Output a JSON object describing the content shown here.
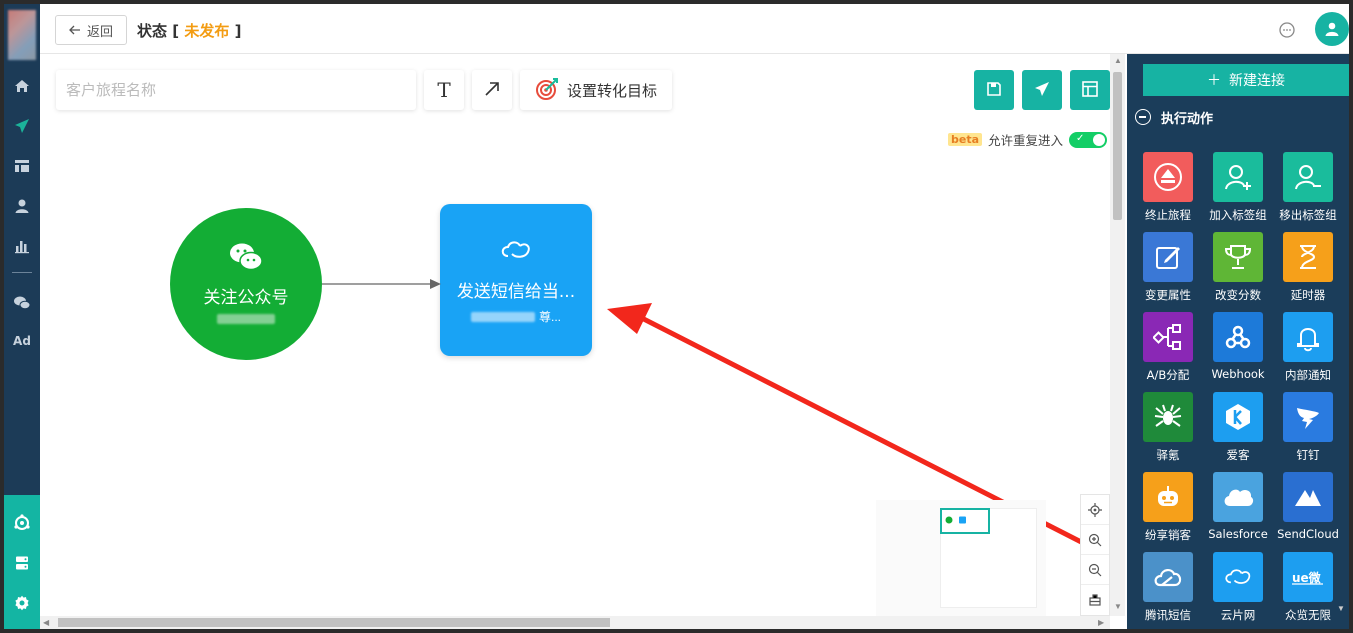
{
  "topbar": {
    "back_label": "返回",
    "status_prefix": "状态",
    "bracket_open": "[",
    "status_value": "未发布",
    "bracket_close": "]"
  },
  "toolbar": {
    "journey_name_placeholder": "客户旅程名称",
    "text_tool_glyph": "T",
    "goal_label": "设置转化目标"
  },
  "reentry": {
    "badge": "beta",
    "label": "允许重复进入",
    "enabled": true
  },
  "nodes": [
    {
      "title": "关注公众号",
      "icon": "wechat-icon"
    },
    {
      "title": "发送短信给当...",
      "subtitle_suffix": "尊...",
      "icon": "sms-cloud-icon"
    }
  ],
  "right_panel": {
    "new_connection": "新建连接",
    "section_title": "执行动作",
    "actions": [
      {
        "label": "终止旅程",
        "color": "#f25c5c",
        "icon": "eject-icon"
      },
      {
        "label": "加入标签组",
        "color": "#1abc9c",
        "icon": "user-add-icon"
      },
      {
        "label": "移出标签组",
        "color": "#1abc9c",
        "icon": "user-remove-icon"
      },
      {
        "label": "变更属性",
        "color": "#3a78d6",
        "icon": "edit-icon"
      },
      {
        "label": "改变分数",
        "color": "#5fb636",
        "icon": "trophy-icon"
      },
      {
        "label": "延时器",
        "color": "#f6a01a",
        "icon": "hourglass-icon"
      },
      {
        "label": "A/B分配",
        "color": "#8a28b5",
        "icon": "split-icon"
      },
      {
        "label": "Webhook",
        "color": "#1d7ad9",
        "icon": "webhook-icon"
      },
      {
        "label": "内部通知",
        "color": "#1d9ef0",
        "icon": "bell-icon"
      },
      {
        "label": "驿氪",
        "color": "#1f8a3a",
        "icon": "spider-icon"
      },
      {
        "label": "爱客",
        "color": "#1d9ef0",
        "icon": "aike-icon"
      },
      {
        "label": "钉钉",
        "color": "#2a7be0",
        "icon": "dingtalk-icon"
      },
      {
        "label": "纷享销客",
        "color": "#f6a01a",
        "icon": "robot-icon"
      },
      {
        "label": "Salesforce",
        "color": "#4aa3df",
        "icon": "salesforce-cloud-icon"
      },
      {
        "label": "SendCloud",
        "color": "#2a6fd1",
        "icon": "sendcloud-icon"
      },
      {
        "label": "腾讯短信",
        "color": "#4b91c9",
        "icon": "tencent-cloud-icon"
      },
      {
        "label": "云片网",
        "color": "#1d9ef0",
        "icon": "yunpian-icon"
      },
      {
        "label": "众览无限",
        "color": "#1d9ef0",
        "icon": "zhonglan-icon"
      }
    ]
  }
}
